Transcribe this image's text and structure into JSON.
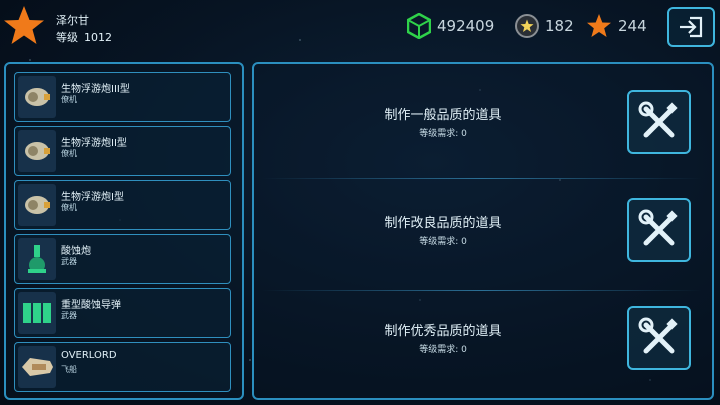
{
  "player": {
    "name": "泽尔甘",
    "level_label": "等级",
    "level_value": "1012"
  },
  "resources": {
    "cubes": "492409",
    "coins": "182",
    "stars": "244"
  },
  "colors": {
    "accent": "#3fb6de",
    "star_orange": "#f07a1a",
    "cube_green": "#2fd24a"
  },
  "items": [
    {
      "name": "生物浮游炮III型",
      "type": "僚机",
      "icon": "bio-drone-icon"
    },
    {
      "name": "生物浮游炮II型",
      "type": "僚机",
      "icon": "bio-drone-icon"
    },
    {
      "name": "生物浮游炮I型",
      "type": "僚机",
      "icon": "bio-drone-icon"
    },
    {
      "name": "酸蚀炮",
      "type": "武器",
      "icon": "acid-cannon-icon"
    },
    {
      "name": "重型酸蚀导弹",
      "type": "武器",
      "icon": "acid-missile-icon"
    },
    {
      "name": "OVERLORD",
      "type": "飞船",
      "icon": "ship-icon"
    }
  ],
  "crafts": [
    {
      "title": "制作一般品质的道具",
      "requirement": "等级需求: 0"
    },
    {
      "title": "制作改良品质的道具",
      "requirement": "等级需求: 0"
    },
    {
      "title": "制作优秀品质的道具",
      "requirement": "等级需求: 0"
    }
  ]
}
